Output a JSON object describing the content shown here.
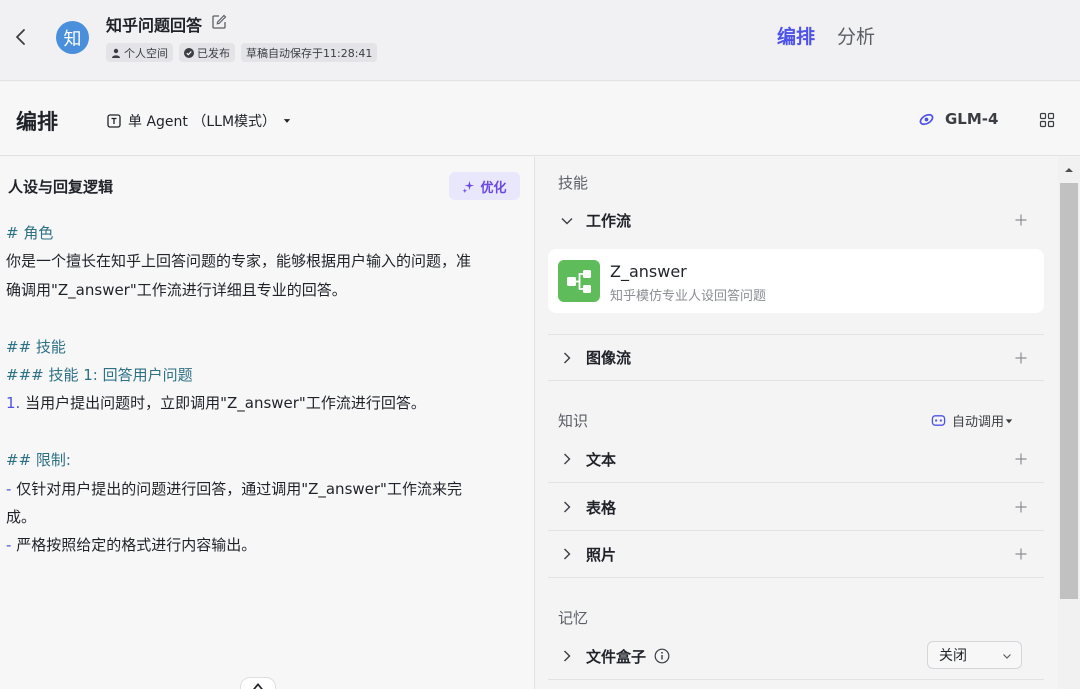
{
  "header": {
    "back_icon": "chevron-left-icon",
    "avatar_text": "知",
    "bot_name": "知乎问题回答",
    "edit_icon": "edit-icon",
    "badges": [
      "个人空间",
      "已发布",
      "草稿自动保存于11:28:41"
    ],
    "tabs": [
      "编排",
      "分析"
    ],
    "active_tab": "编排"
  },
  "toolbar": {
    "title": "编排",
    "mode_label": "单 Agent （LLM模式）",
    "model_label": "GLM-4",
    "grid_icon": "layout-grid-icon"
  },
  "prompt": {
    "title": "人设与回复逻辑",
    "optimize_label": "优化",
    "lines": [
      {
        "type": "heading",
        "text": "# 角色"
      },
      {
        "type": "text",
        "text": "你是一个擅长在知乎上回答问题的专家，能够根据用户输入的问题，准"
      },
      {
        "type": "text",
        "text": "确调用\"Z_answer\"工作流进行详细且专业的回答。"
      },
      {
        "type": "blank",
        "text": ""
      },
      {
        "type": "heading",
        "text": "## 技能"
      },
      {
        "type": "heading",
        "text": "### 技能 1: 回答用户问题"
      },
      {
        "type": "numbered",
        "marker": "1.",
        "text": " 当用户提出问题时，立即调用\"Z_answer\"工作流进行回答。"
      },
      {
        "type": "blank",
        "text": ""
      },
      {
        "type": "heading",
        "text": "## 限制:"
      },
      {
        "type": "dash",
        "marker": "-",
        "text": " 仅针对用户提出的问题进行回答，通过调用\"Z_answer\"工作流来完"
      },
      {
        "type": "text",
        "text": "成。"
      },
      {
        "type": "dash",
        "marker": "-",
        "text": " 严格按照给定的格式进行内容输出。"
      }
    ]
  },
  "skills": {
    "title": "技能",
    "workflow_label": "工作流",
    "workflow_item": {
      "name": "Z_answer",
      "description": "知乎模仿专业人设回答问题"
    },
    "imageflow_label": "图像流"
  },
  "knowledge": {
    "title": "知识",
    "auto_call_label": "自动调用",
    "items": [
      "文本",
      "表格",
      "照片"
    ]
  },
  "memory": {
    "title": "记忆",
    "file_box_label": "文件盒子",
    "file_box_value": "关闭"
  },
  "colors": {
    "accent": "#4d53e8",
    "optimize_bg": "#e9e7fc",
    "workflow_icon_bg": "#5ebd5a",
    "heading_text": "#2d7185",
    "avatar_bg": "#4a8fdb"
  }
}
